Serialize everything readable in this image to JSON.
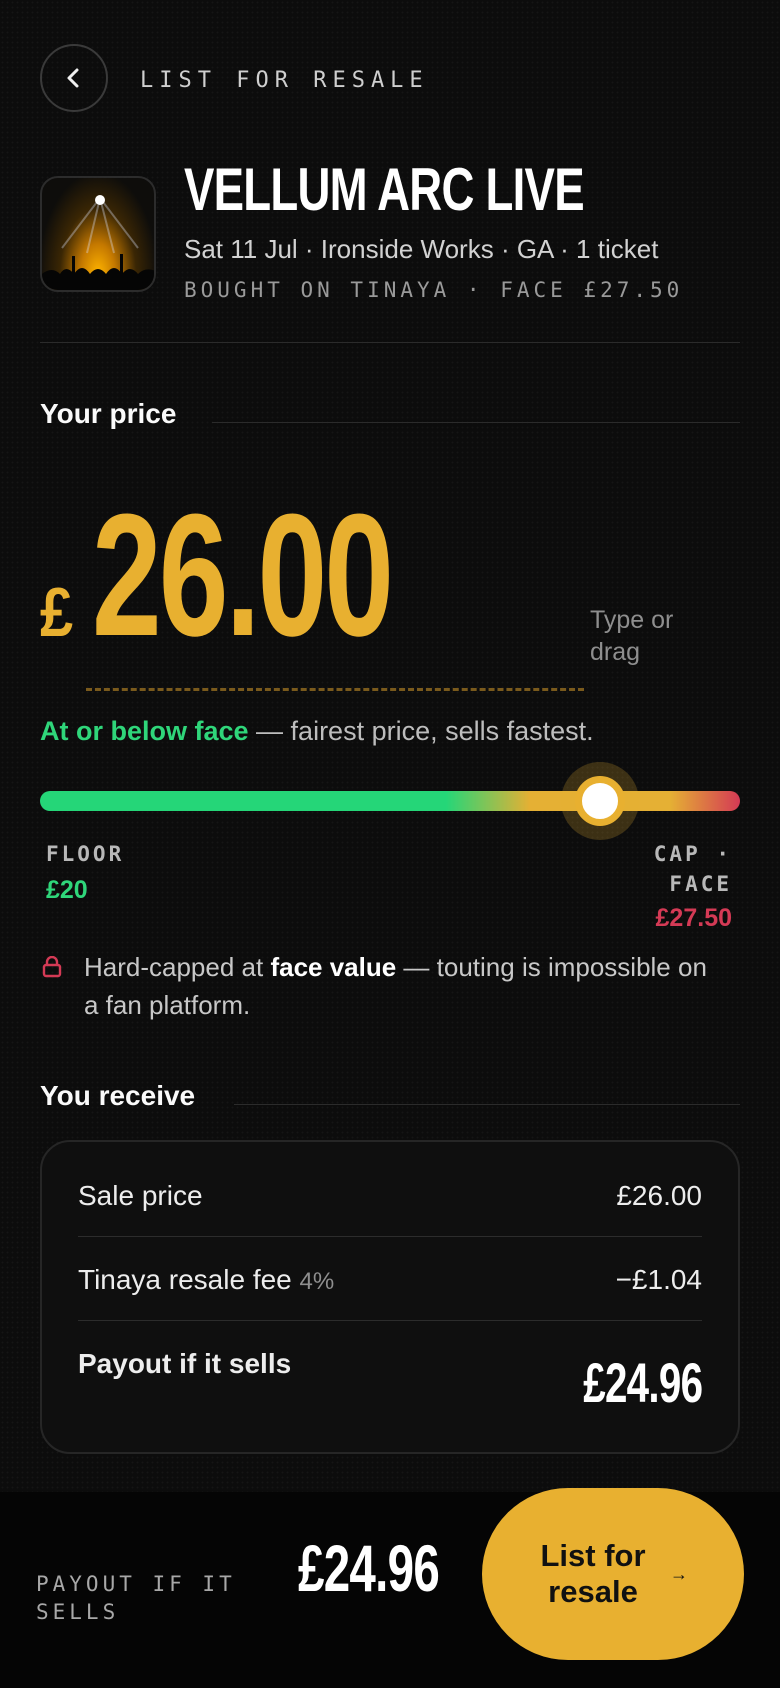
{
  "header": {
    "title": "LIST FOR RESALE",
    "back_icon": "chevron-left-icon"
  },
  "event": {
    "title": "VELLUM ARC LIVE",
    "subtitle": "Sat 11 Jul · Ironside Works · GA · 1 ticket",
    "meta": "BOUGHT ON TINAYA · FACE £27.50"
  },
  "price": {
    "section_title": "Your price",
    "currency": "£",
    "amount": "26.00",
    "hint": "Type or drag",
    "status_strong": "At or below face",
    "status_rest": " — fairest price, sells fastest.",
    "slider": {
      "min": 20,
      "max": 27.5,
      "value": 26,
      "floor_label": "FLOOR",
      "floor_value": "£20",
      "cap_label_1": "CAP ·",
      "cap_label_2": "FACE",
      "cap_value": "£27.50"
    },
    "note_prefix": "Hard-capped at ",
    "note_strong": "face value",
    "note_suffix": " — touting is impossible on a fan platform."
  },
  "receive": {
    "section_title": "You receive",
    "sale_label": "Sale price",
    "sale_value": "£26.00",
    "fee_label": "Tinaya resale fee",
    "fee_pct": "4%",
    "fee_value": "−£1.04",
    "payout_label": "Payout if it sells",
    "payout_value": "£24.96"
  },
  "bottom": {
    "label": "PAYOUT IF IT SELLS",
    "amount": "£24.96",
    "cta_label": "List for resale",
    "cta_arrow": "→"
  },
  "colors": {
    "accent": "#e8b030",
    "green": "#2fd67a",
    "red": "#d43a55",
    "background": "#0c0c0c"
  }
}
